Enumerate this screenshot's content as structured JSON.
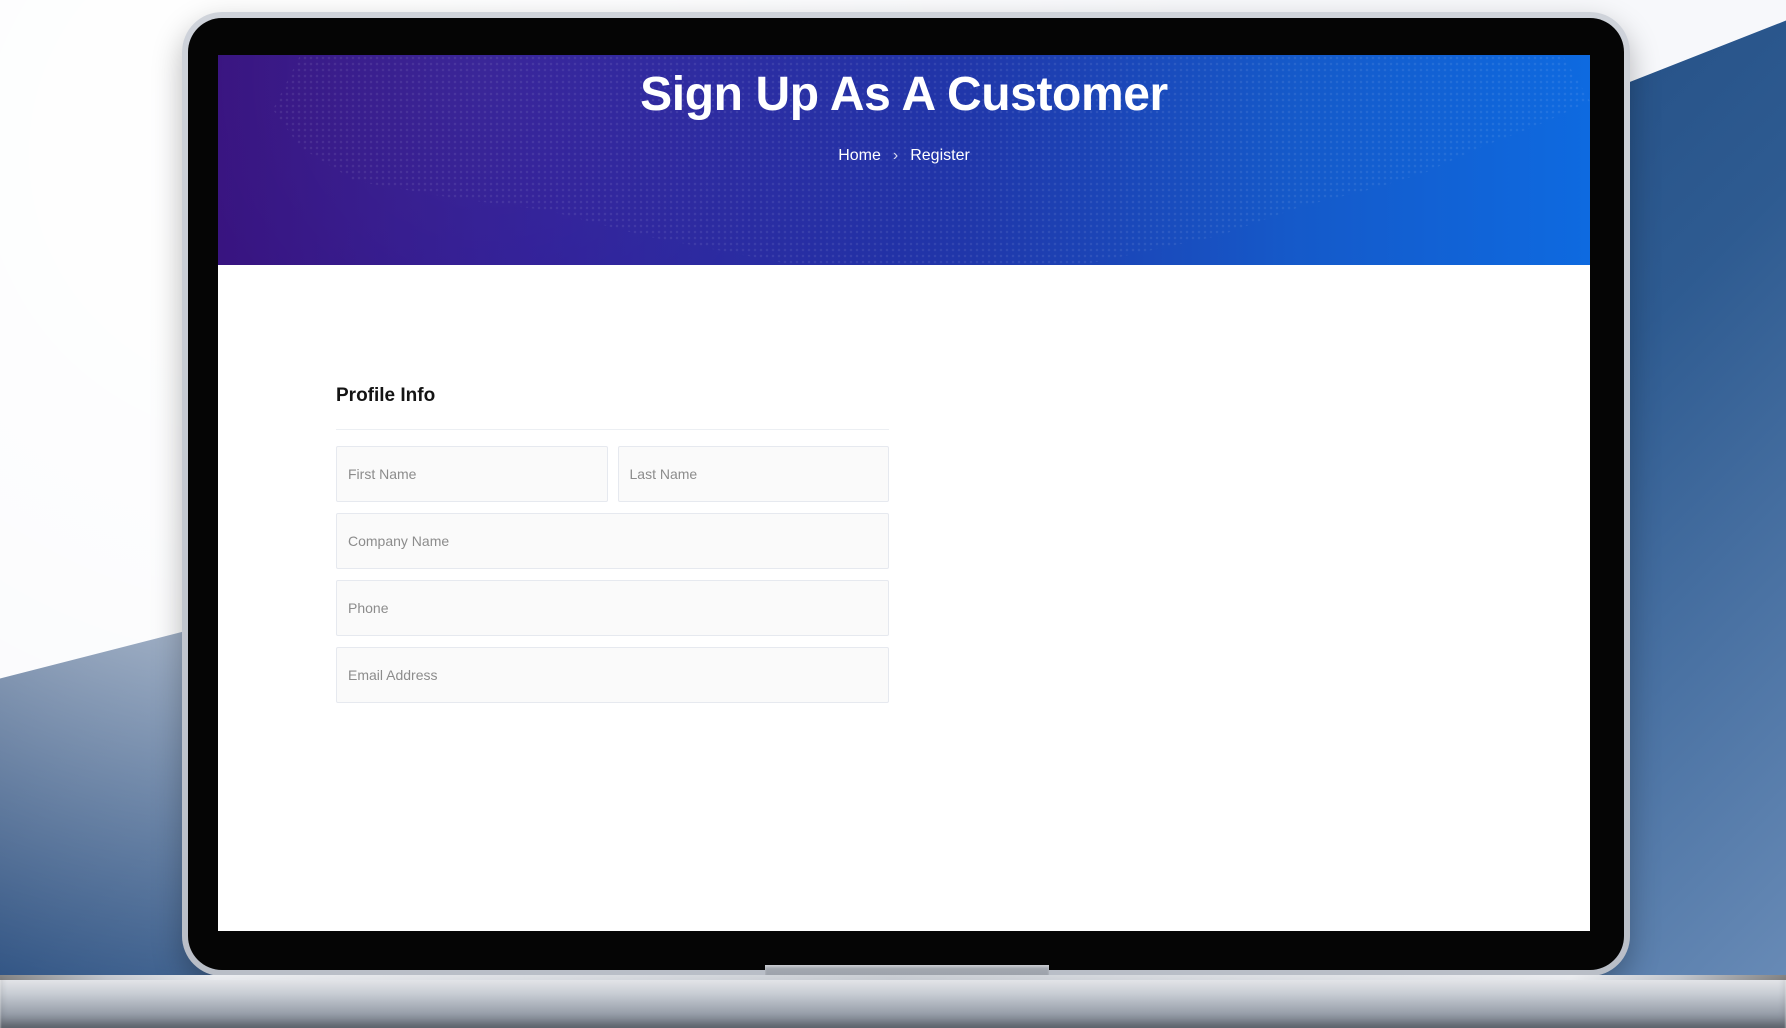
{
  "hero": {
    "title": "Sign Up As A Customer",
    "breadcrumb": {
      "items": [
        "Home",
        "Register"
      ],
      "separator": "›"
    }
  },
  "form": {
    "section_title": "Profile Info",
    "fields": {
      "first_name": {
        "placeholder": "First Name",
        "value": ""
      },
      "last_name": {
        "placeholder": "Last Name",
        "value": ""
      },
      "company_name": {
        "placeholder": "Company Name",
        "value": ""
      },
      "phone": {
        "placeholder": "Phone",
        "value": ""
      },
      "email_address": {
        "placeholder": "Email Address",
        "value": ""
      }
    }
  },
  "colors": {
    "hero_start": "#35107e",
    "hero_end": "#0e6ae0",
    "page_bg": "#ffffff",
    "bg_shape": "#0d2b5a"
  }
}
